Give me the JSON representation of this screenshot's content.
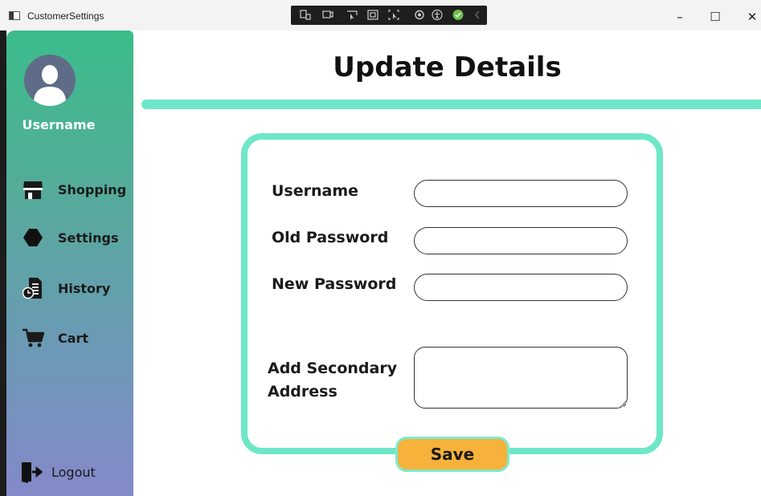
{
  "window": {
    "title": "CustomerSettings",
    "minimize": "–",
    "maximize": "☐",
    "close": "✕"
  },
  "sidebar": {
    "username": "Username",
    "items": [
      {
        "label": "Shopping",
        "icon": "store-icon"
      },
      {
        "label": "Settings",
        "icon": "hexagon-icon"
      },
      {
        "label": "History",
        "icon": "document-clock-icon"
      },
      {
        "label": "Cart",
        "icon": "cart-icon"
      }
    ],
    "logout": "Logout"
  },
  "main": {
    "title": "Update Details",
    "form": {
      "username_label": "Username",
      "username_value": "",
      "old_password_label": "Old Password",
      "old_password_value": "",
      "new_password_label": "New Password",
      "new_password_value": "",
      "secondary_address_label_line1": "Add Secondary",
      "secondary_address_label_line2": "Address",
      "secondary_address_value": "",
      "save_label": "Save"
    }
  },
  "colors": {
    "accent": "#6ee7c8",
    "save_button": "#f6b23a",
    "sidebar_top": "#3bbd8a",
    "sidebar_bottom": "#8489c9"
  }
}
